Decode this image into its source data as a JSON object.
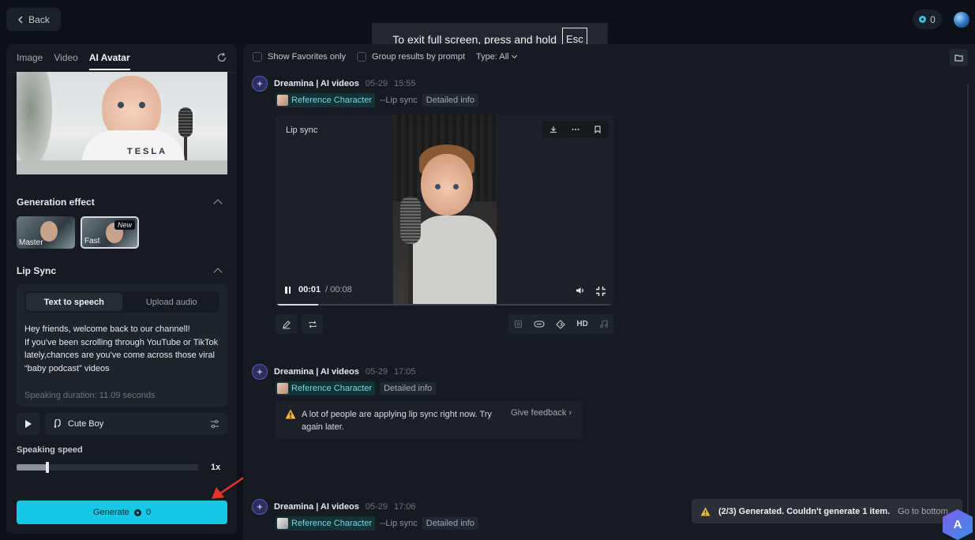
{
  "topbar": {
    "back_label": "Back",
    "credits": "0"
  },
  "fullscreen_hint": {
    "text": "To exit full screen, press and hold",
    "key": "Esc"
  },
  "left": {
    "tabs": [
      "Image",
      "Video",
      "AI Avatar"
    ],
    "active_tab": "AI Avatar",
    "reference_image_text": "TESLA",
    "generation_effect": {
      "title": "Generation effect",
      "options": [
        {
          "label": "Master",
          "selected": false
        },
        {
          "label": "Fast",
          "selected": true,
          "badge": "New"
        }
      ]
    },
    "lip_sync": {
      "title": "Lip Sync",
      "modes": [
        "Text to speech",
        "Upload audio"
      ],
      "active_mode": "Text to speech",
      "script": [
        "Hey friends, welcome back to our channell!",
        "If you've been scrolling through YouTube or TikTok lately,chances are you've come across those viral",
        "“baby podcast” videos"
      ],
      "duration": "Speaking duration: 11.09 seconds"
    },
    "voice": "Cute Boy",
    "speed": {
      "label": "Speaking speed",
      "value": "1x",
      "level": 0.17
    },
    "generate": {
      "label": "Generate",
      "cost": "0"
    }
  },
  "right": {
    "filters": {
      "favorites": "Show Favorites only",
      "group": "Group results by prompt",
      "type": "Type: All"
    },
    "entries": [
      {
        "title": "Dreamina | AI videos",
        "date": "05-29",
        "time": "15:55",
        "ref": "Reference Character",
        "mode": "--Lip sync",
        "detail": "Detailed info"
      },
      {
        "title": "Dreamina | AI videos",
        "date": "05-29",
        "time": "17:05",
        "ref": "Reference Character",
        "mode": "",
        "detail": "Detailed info"
      },
      {
        "title": "Dreamina | AI videos",
        "date": "05-29",
        "time": "17:06",
        "ref": "Reference Character",
        "mode": "--Lip sync",
        "detail": "Detailed info"
      }
    ],
    "video": {
      "label": "Lip sync",
      "current": "00:01",
      "total": "/ 00:08",
      "progress": 0.125
    },
    "toolstrip_hd": "HD",
    "warning": {
      "text": "A lot of people are applying lip sync right now. Try again later.",
      "feedback": "Give feedback"
    },
    "status_toast": {
      "text": "(2/3) Generated. Couldn't generate 1 item.",
      "goto": "Go to bottom"
    }
  },
  "badge_letters": "A",
  "colors": {
    "accent": "#15c9e6",
    "ref_tag_bg": "#123338",
    "ref_tag_text": "#7ad6dd",
    "warning": "#f5b73b"
  }
}
